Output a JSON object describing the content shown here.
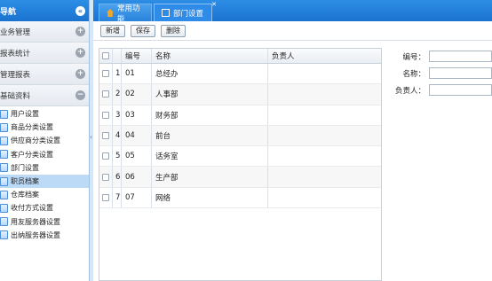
{
  "sidebar": {
    "title": "导航",
    "collapse_glyph": "«",
    "groups": [
      {
        "label": "业务管理",
        "state": "collapsed"
      },
      {
        "label": "报表统计",
        "state": "collapsed"
      },
      {
        "label": "管理报表",
        "state": "collapsed"
      },
      {
        "label": "基础资料",
        "state": "expanded"
      }
    ],
    "items": [
      {
        "label": "用户设置"
      },
      {
        "label": "商品分类设置"
      },
      {
        "label": "供应商分类设置"
      },
      {
        "label": "客户分类设置"
      },
      {
        "label": "部门设置"
      },
      {
        "label": "职员档案",
        "selected": true
      },
      {
        "label": "仓库档案"
      },
      {
        "label": "收付方式设置"
      },
      {
        "label": "用友服务器设置"
      },
      {
        "label": "出纳服务器设置"
      }
    ]
  },
  "tabs": [
    {
      "label": "常用功能",
      "icon": "home-icon"
    },
    {
      "label": "部门设置",
      "icon": "document-icon",
      "active": true
    }
  ],
  "toolbar": {
    "new_label": "新增",
    "save_label": "保存",
    "delete_label": "删除"
  },
  "grid": {
    "columns": {
      "code": "编号",
      "name": "名称",
      "head": "负责人"
    },
    "rows": [
      {
        "num": "1",
        "code": "01",
        "name": "总经办",
        "head": ""
      },
      {
        "num": "2",
        "code": "02",
        "name": "人事部",
        "head": ""
      },
      {
        "num": "3",
        "code": "03",
        "name": "财务部",
        "head": ""
      },
      {
        "num": "4",
        "code": "04",
        "name": "前台",
        "head": ""
      },
      {
        "num": "5",
        "code": "05",
        "name": "话务室",
        "head": ""
      },
      {
        "num": "6",
        "code": "06",
        "name": "生产部",
        "head": ""
      },
      {
        "num": "7",
        "code": "07",
        "name": "网络",
        "head": ""
      }
    ]
  },
  "form": {
    "code_label": "编号：",
    "code_value": "",
    "name_label": "名称：",
    "name_value": "",
    "head_label": "负责人：",
    "head_value": ""
  },
  "colors": {
    "header_blue": "#1a73cf",
    "selected_row": "#bcd9f6"
  }
}
